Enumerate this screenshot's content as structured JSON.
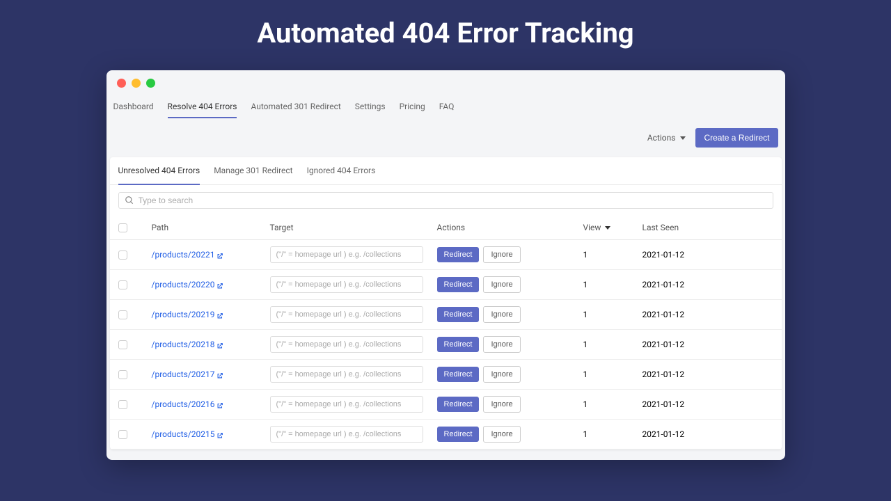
{
  "page_heading": "Automated 404 Error Tracking",
  "nav": {
    "items": [
      "Dashboard",
      "Resolve 404 Errors",
      "Automated 301 Redirect",
      "Settings",
      "Pricing",
      "FAQ"
    ],
    "active_index": 1
  },
  "toolbar": {
    "actions_label": "Actions",
    "create_redirect_label": "Create a Redirect"
  },
  "subtabs": {
    "items": [
      "Unresolved 404 Errors",
      "Manage 301 Redirect",
      "Ignored 404 Errors"
    ],
    "active_index": 0
  },
  "search": {
    "placeholder": "Type to search"
  },
  "table": {
    "headers": {
      "path": "Path",
      "target": "Target",
      "actions": "Actions",
      "view": "View",
      "last_seen": "Last Seen"
    },
    "target_placeholder": "(\"/\" = homepage url ) e.g. /collections",
    "redirect_label": "Redirect",
    "ignore_label": "Ignore",
    "rows": [
      {
        "path": "/products/20221",
        "view": "1",
        "last_seen": "2021-01-12"
      },
      {
        "path": "/products/20220",
        "view": "1",
        "last_seen": "2021-01-12"
      },
      {
        "path": "/products/20219",
        "view": "1",
        "last_seen": "2021-01-12"
      },
      {
        "path": "/products/20218",
        "view": "1",
        "last_seen": "2021-01-12"
      },
      {
        "path": "/products/20217",
        "view": "1",
        "last_seen": "2021-01-12"
      },
      {
        "path": "/products/20216",
        "view": "1",
        "last_seen": "2021-01-12"
      },
      {
        "path": "/products/20215",
        "view": "1",
        "last_seen": "2021-01-12"
      }
    ]
  }
}
